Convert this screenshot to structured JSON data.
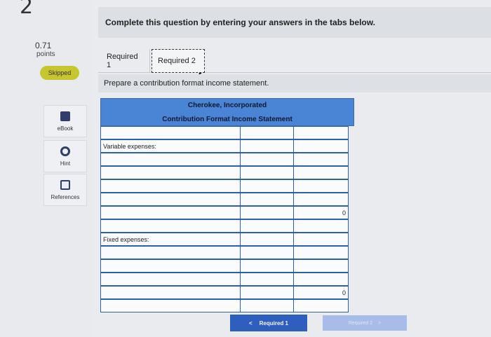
{
  "question": {
    "number": "2",
    "points_value": "0.71",
    "points_label": "points",
    "status": "Skipped"
  },
  "tools": [
    {
      "label": "eBook",
      "icon": "ebook-icon"
    },
    {
      "label": "Hint",
      "icon": "hint-icon"
    },
    {
      "label": "References",
      "icon": "references-icon"
    }
  ],
  "instructions": "Complete this question by entering your answers in the tabs below.",
  "tabs": [
    {
      "label": "Required 1"
    },
    {
      "label": "Required 2"
    }
  ],
  "prompt": "Prepare a contribution format income statement.",
  "statement": {
    "company": "Cherokee, Incorporated",
    "title": "Contribution Format Income Statement",
    "variable_label": "Variable expenses:",
    "variable_total": "0",
    "fixed_label": "Fixed expenses:",
    "fixed_total": "0"
  },
  "nav": {
    "prev_label": "Required 1",
    "prev_arrow": "<",
    "next_label": "Required 2",
    "next_arrow": ">"
  },
  "colors": {
    "header_blue": "#4a84d4",
    "border_blue": "#2b5fb0",
    "button_blue": "#2e5fbf",
    "skipped_yellow": "#c8c62e"
  }
}
